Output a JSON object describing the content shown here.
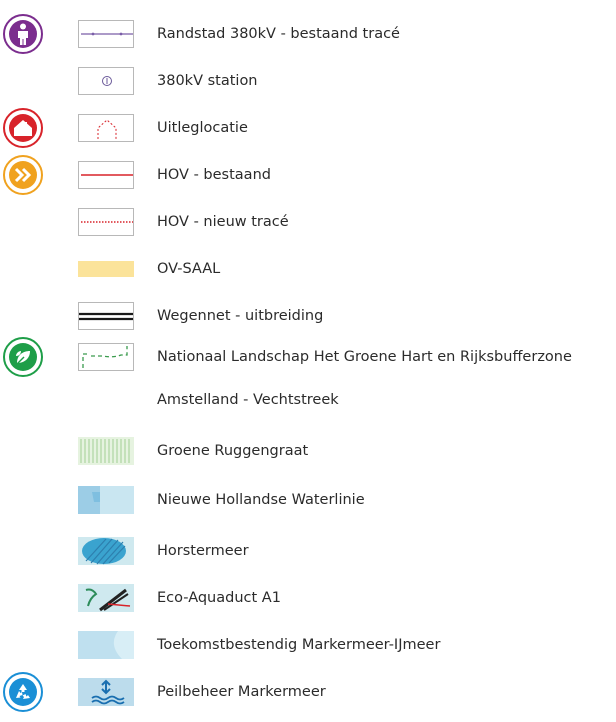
{
  "legend": {
    "items": [
      {
        "label": "Randstad 380kV - bestaand tracé",
        "swatch": "purple-line-swatch",
        "category_icon": "person-icon"
      },
      {
        "label": "380kV station",
        "swatch": "station-symbol-swatch",
        "category_icon": null
      },
      {
        "label": "Uitleglocatie",
        "swatch": "dotted-house-outline-swatch",
        "category_icon": "house-icon"
      },
      {
        "label": "HOV - bestaand",
        "swatch": "red-line-swatch",
        "category_icon": "double-chevron-icon"
      },
      {
        "label": "HOV - nieuw tracé",
        "swatch": "red-dotted-line-swatch",
        "category_icon": null
      },
      {
        "label": "OV-SAAL",
        "swatch": "yellow-band-swatch",
        "category_icon": null
      },
      {
        "label": "Wegennet - uitbreiding",
        "swatch": "black-double-line-swatch",
        "category_icon": null
      },
      {
        "label": "Nationaal Landschap Het Groene Hart en Rijksbufferzone",
        "swatch": "green-dashed-boundary-swatch",
        "category_icon": "leaf-icon"
      },
      {
        "label": "Amstelland - Vechtstreek",
        "swatch": null,
        "category_icon": null
      },
      {
        "label": "Groene Ruggengraat",
        "swatch": "green-hatch-swatch",
        "category_icon": null
      },
      {
        "label": "Nieuwe Hollandse Waterlinie",
        "swatch": "blue-waterline-swatch",
        "category_icon": null
      },
      {
        "label": "Horstermeer",
        "swatch": "blue-polder-swatch",
        "category_icon": null
      },
      {
        "label": "Eco-Aquaduct A1",
        "swatch": "aquaduct-swatch",
        "category_icon": null
      },
      {
        "label": "Toekomstbestendig Markermeer-IJmeer",
        "swatch": "light-blue-lake-swatch",
        "category_icon": null
      },
      {
        "label": "Peilbeheer Markermeer",
        "swatch": "water-level-swatch",
        "category_icon": "recycle-icon"
      }
    ]
  },
  "colors": {
    "purple": "#7b2d8e",
    "red": "#d8232a",
    "orange": "#f0a21f",
    "green": "#1e9e48",
    "blue": "#1a8fd6"
  }
}
